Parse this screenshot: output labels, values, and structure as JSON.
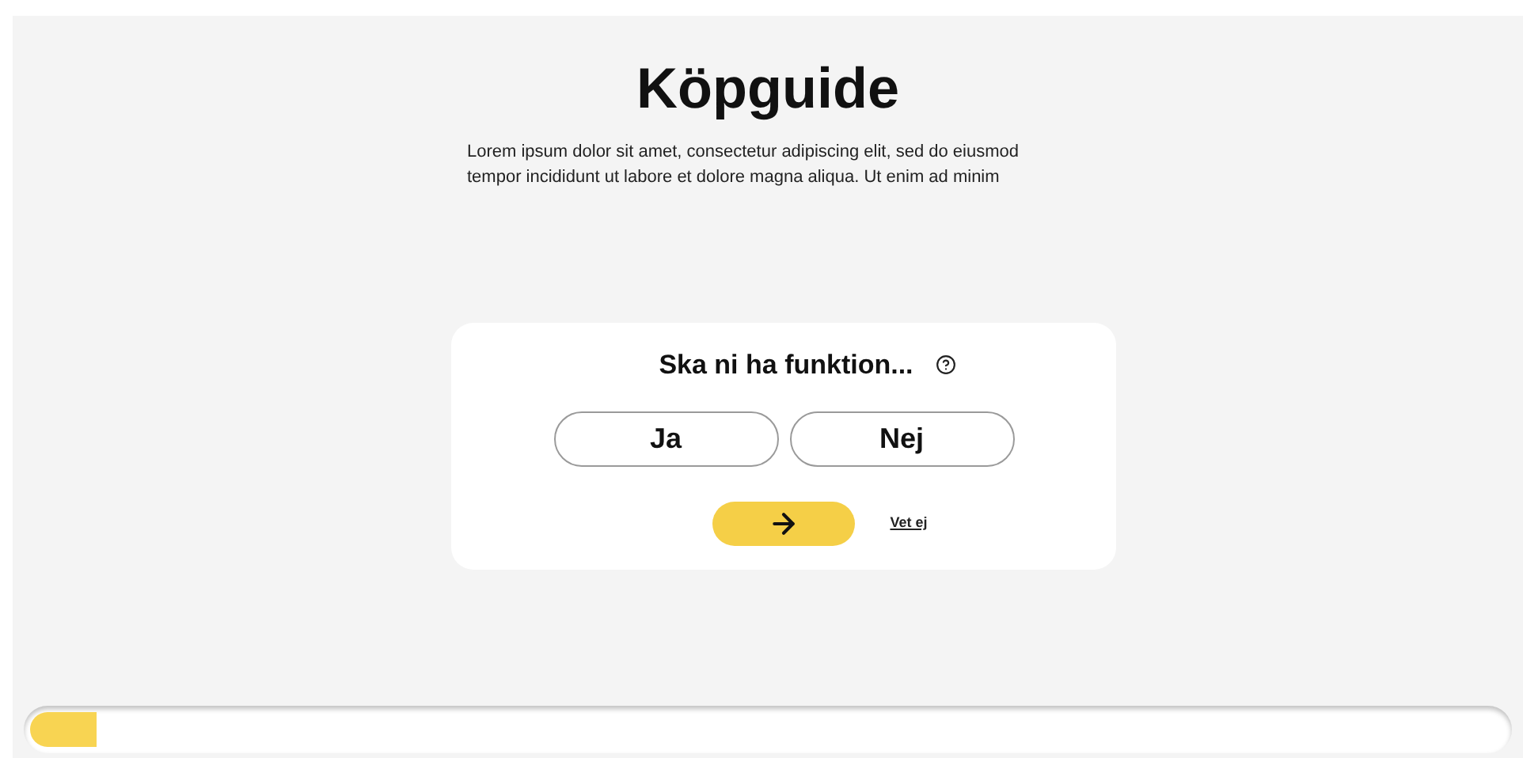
{
  "title": "Köpguide",
  "intro": "Lorem ipsum dolor sit amet, consectetur adipiscing elit, sed do eiusmod tempor incididunt ut labore et dolore magna aliqua. Ut enim ad minim",
  "question": {
    "text": "Ska ni ha funktion...",
    "options": [
      {
        "label": "Ja",
        "selected": false
      },
      {
        "label": "Nej",
        "selected": false
      }
    ],
    "skip_link": "Vet ej"
  },
  "progress": {
    "level": 0.045
  }
}
